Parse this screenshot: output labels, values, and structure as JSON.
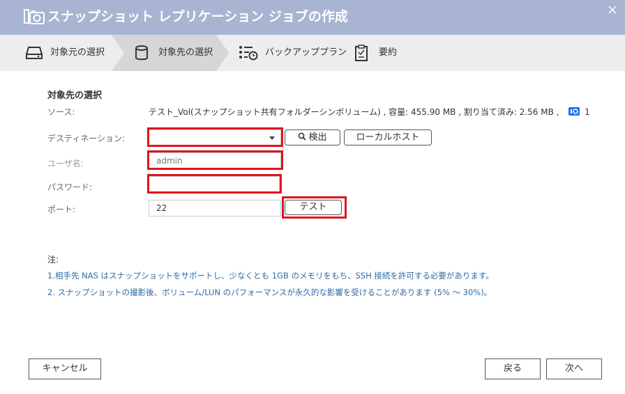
{
  "window": {
    "title": "スナップショット レプリケーション ジョブの作成",
    "close_label": "×"
  },
  "steps": [
    {
      "label": "対象元の選択",
      "icon": "drive-icon",
      "state": "done"
    },
    {
      "label": "対象先の選択",
      "icon": "database-icon",
      "state": "current"
    },
    {
      "label": "バックアッププラン",
      "icon": "schedule-list-icon",
      "state": "pending"
    },
    {
      "label": "要約",
      "icon": "clipboard-icon",
      "state": "pending"
    }
  ],
  "form": {
    "section_title": "対象先の選択",
    "source": {
      "label": "ソース:",
      "value": "テスト_Vol(スナップショット共有フォルダーシンボリューム) , 容量: 455.90 MB , 割り当て済み: 2.56 MB ,",
      "snapshot_count": "1"
    },
    "destination": {
      "label": "デスティネーション:",
      "value": ""
    },
    "search_button": "検出",
    "localhost_button": "ローカルホスト",
    "username": {
      "label": "ユーザ名:",
      "value": "",
      "placeholder": "admin"
    },
    "password": {
      "label": "パスワード:",
      "value": ""
    },
    "port": {
      "label": "ポート:",
      "value": "22"
    },
    "test_button": "テスト"
  },
  "notes": {
    "title": "注:",
    "items": [
      "1.相手先 NAS はスナップショットをサポートし、少なくとも 1GB のメモリをもち、SSH 接続を許可する必要があります。",
      "2. スナップショットの撮影後、ボリューム/LUN のパフォーマンスが永久的な影響を受けることがあります (5% ～ 30%)。"
    ]
  },
  "footer": {
    "cancel": "キャンセル",
    "back": "戻る",
    "next": "次へ"
  },
  "colors": {
    "titlebar": "#a8b4d2",
    "stepbar": "#ededed",
    "current_step": "#d6d6d6",
    "highlight": "#e0141e",
    "note_text": "#2f6aa8",
    "badge": "#1a73e8"
  }
}
